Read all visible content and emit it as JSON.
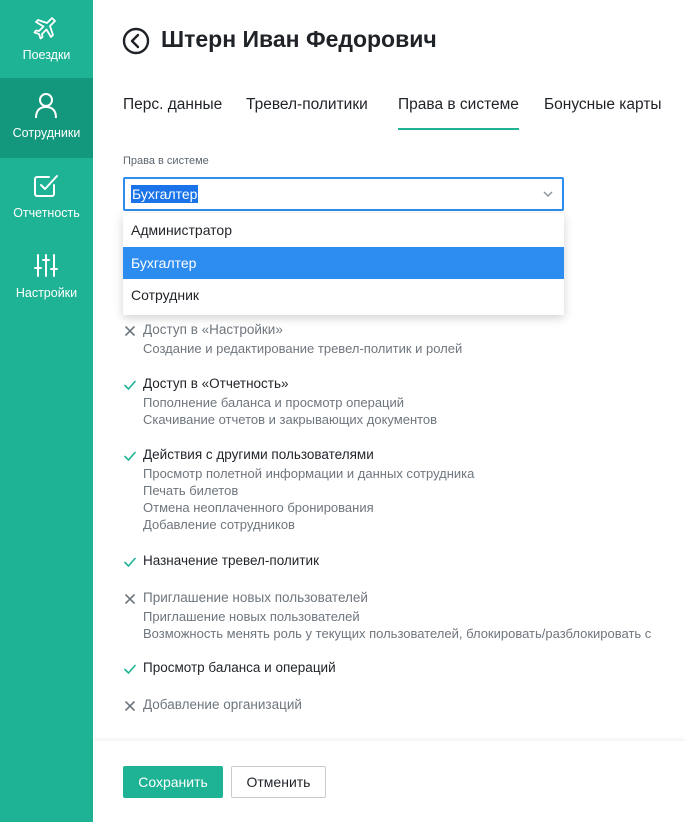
{
  "sidebar": {
    "items": [
      {
        "label": "Поездки",
        "icon": "plane-icon"
      },
      {
        "label": "Сотрудники",
        "icon": "user-icon"
      },
      {
        "label": "Отчетность",
        "icon": "check-square-icon"
      },
      {
        "label": "Настройки",
        "icon": "sliders-icon"
      }
    ],
    "active": "Сотрудники",
    "colors": {
      "bg": "#1eb394",
      "active_bg": "#13987d"
    }
  },
  "header": {
    "title": "Штерн Иван Федорович",
    "back_icon": "back-circle-icon"
  },
  "tabs": [
    {
      "label": "Перс. данные"
    },
    {
      "label": "Тревел-политики"
    },
    {
      "label": "Права в системе"
    },
    {
      "label": "Бонусные карты"
    }
  ],
  "active_tab": "Права в системе",
  "rights": {
    "label": "Права в системе",
    "value": "Бухгалтер",
    "options": [
      "Администратор",
      "Бухгалтер",
      "Сотрудник"
    ],
    "selected": "Бухгалтер"
  },
  "permissions": [
    {
      "title": "Доступ в «Настройки»",
      "enabled": false,
      "details": [
        "Создание и редактирование тревел-политик и ролей"
      ]
    },
    {
      "title": "Доступ в «Отчетность»",
      "enabled": true,
      "details": [
        "Пополнение баланса и просмотр операций",
        "Скачивание отчетов и закрывающих документов"
      ]
    },
    {
      "title": "Действия с другими пользователями",
      "enabled": true,
      "details": [
        "Просмотр полетной информации и данных сотрудника",
        "Печать билетов",
        "Отмена неоплаченного бронирования",
        "Добавление сотрудников"
      ]
    },
    {
      "title": "Назначение тревел-политик",
      "enabled": true,
      "details": []
    },
    {
      "title": "Приглашение новых пользователей",
      "enabled": false,
      "details": [
        "Приглашение новых пользователей",
        "Возможность менять роль у текущих пользователей, блокировать/разблокировать с"
      ]
    },
    {
      "title": "Просмотр баланса и операций",
      "enabled": true,
      "details": []
    },
    {
      "title": "Добавление организаций",
      "enabled": false,
      "details": []
    }
  ],
  "footer": {
    "save_label": "Сохранить",
    "cancel_label": "Отменить"
  },
  "colors": {
    "accent": "#1eb394",
    "focus": "#2d8cf0",
    "check": "#1eb394",
    "cross": "#6e767e"
  }
}
